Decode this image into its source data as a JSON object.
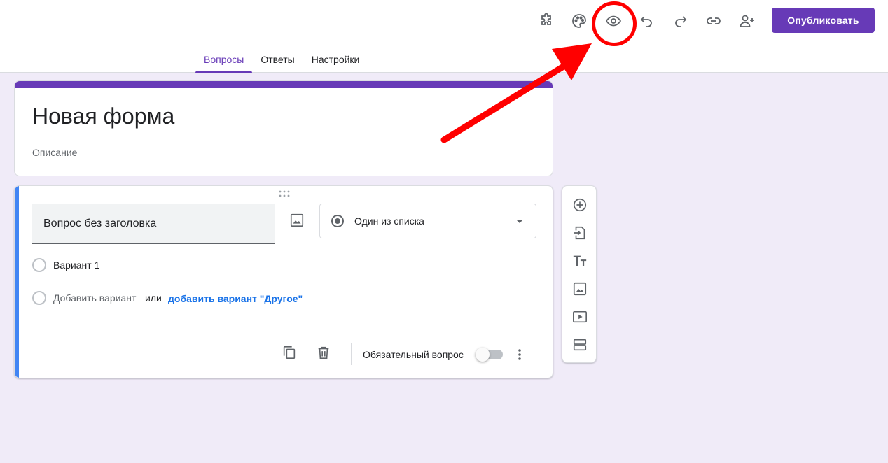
{
  "toolbar": {
    "publish_label": "Опубликовать",
    "icons": [
      "addons-icon",
      "palette-icon",
      "preview-icon",
      "undo-icon",
      "redo-icon",
      "link-icon",
      "add-collaborator-icon"
    ]
  },
  "tabs": [
    {
      "label": "Вопросы",
      "active": true
    },
    {
      "label": "Ответы",
      "active": false
    },
    {
      "label": "Настройки",
      "active": false
    }
  ],
  "form": {
    "title": "Новая форма",
    "description": "Описание"
  },
  "question": {
    "title": "Вопрос без заголовка",
    "type_label": "Один из списка",
    "option1": "Вариант 1",
    "add_option": "Добавить вариант",
    "or": "или",
    "add_other": "добавить вариант \"Другое\"",
    "required_label": "Обязательный вопрос",
    "required": false
  },
  "side_toolbar": {
    "icons": [
      "add-question-icon",
      "import-questions-icon",
      "add-title-icon",
      "add-image-icon",
      "add-video-icon",
      "add-section-icon"
    ]
  },
  "colors": {
    "accent": "#673ab7",
    "background": "#f0ebf8",
    "active_card_bar": "#4285f4",
    "annotation": "#ff0000",
    "link": "#1a73e8"
  }
}
